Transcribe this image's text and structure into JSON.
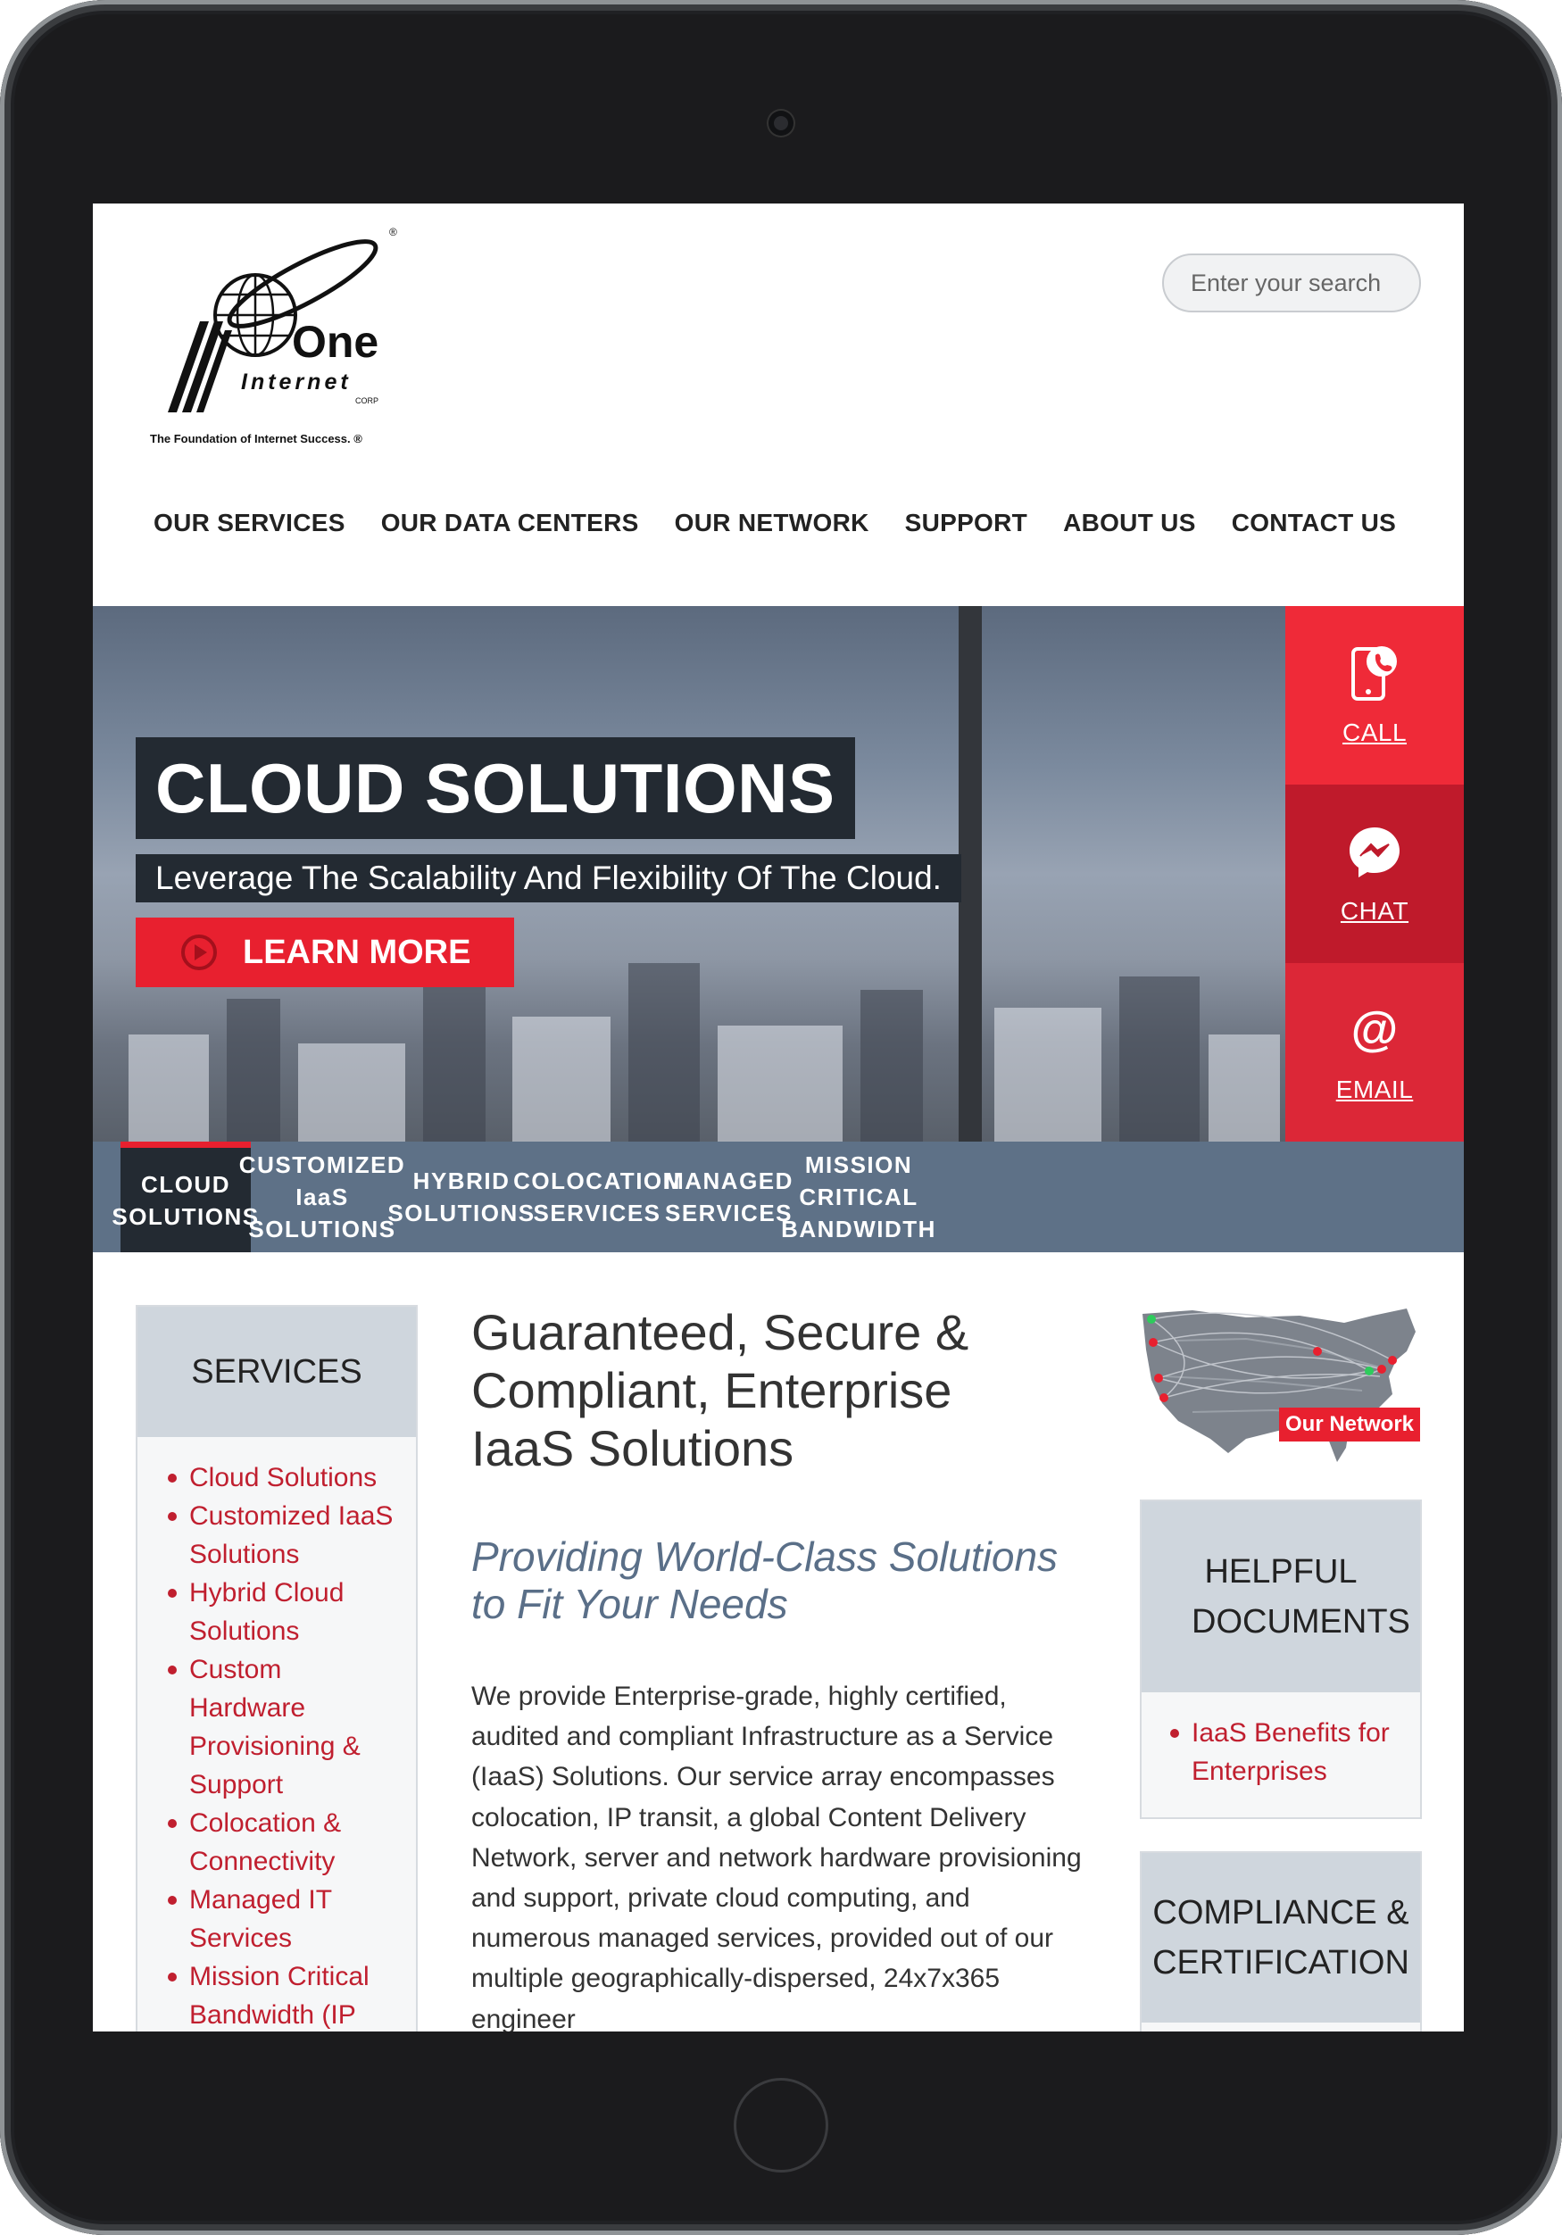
{
  "header": {
    "logo_text": "One",
    "logo_subtext": "Internet",
    "logo_corp": "CORP",
    "logo_tagline": "The Foundation of Internet Success. ®",
    "search_placeholder": "Enter your search"
  },
  "nav": [
    "OUR SERVICES",
    "OUR DATA CENTERS",
    "OUR NETWORK",
    "SUPPORT",
    "ABOUT US",
    "CONTACT US"
  ],
  "hero": {
    "title": "CLOUD SOLUTIONS",
    "subtitle": "Leverage The Scalability And Flexibility Of The Cloud.",
    "button_label": "LEARN MORE"
  },
  "contact_rail": [
    {
      "label": "CALL",
      "icon": "phone-icon",
      "color": "#ef2a38"
    },
    {
      "label": "CHAT",
      "icon": "messenger-icon",
      "color": "#bf1a2b"
    },
    {
      "label": "EMAIL",
      "icon": "at-sign-icon",
      "color": "#dc2737"
    }
  ],
  "tabs": [
    {
      "line1": "CLOUD",
      "line2": "SOLUTIONS",
      "active": true
    },
    {
      "line1": "CUSTOMIZED IaaS",
      "line2": "SOLUTIONS"
    },
    {
      "line1": "HYBRID",
      "line2": "SOLUTIONS"
    },
    {
      "line1": "COLOCATION",
      "line2": "SERVICES"
    },
    {
      "line1": "MANAGED",
      "line2": "SERVICES"
    },
    {
      "line1": "MISSION",
      "line2": "CRITICAL",
      "line3": "BANDWIDTH"
    }
  ],
  "sidebar": {
    "title": "SERVICES",
    "items": [
      "Cloud Solutions",
      "Customized IaaS Solutions",
      "Hybrid Cloud Solutions",
      "Custom Hardware Provisioning & Support",
      "Colocation & Connectivity",
      "Managed IT Services",
      "Mission Critical Bandwidth (IP"
    ]
  },
  "main": {
    "heading": "Guaranteed, Secure & Compliant, Enterprise IaaS Solutions",
    "subheading": "Providing World-Class Solutions to Fit Your Needs",
    "body": "We provide Enterprise-grade, highly certified, audited and compliant Infrastructure as a Service (IaaS) Solutions. Our service array encompasses colocation, IP transit, a global Content Delivery Network, server and network hardware provisioning and support, private cloud computing, and numerous managed services, provided out of our multiple geographically-dispersed, 24x7x365 engineer"
  },
  "right": {
    "map_label": "Our Network",
    "helpful_title": "HELPFUL DOCUMENTS",
    "helpful_items": [
      "IaaS Benefits for Enterprises"
    ],
    "compliance_title": "COMPLIANCE & CERTIFICATION"
  },
  "colors": {
    "accent_red": "#e8202f",
    "nav_blue": "#5e7187",
    "dark_navy": "#232a32",
    "panel_gray": "#cfd6dd"
  }
}
